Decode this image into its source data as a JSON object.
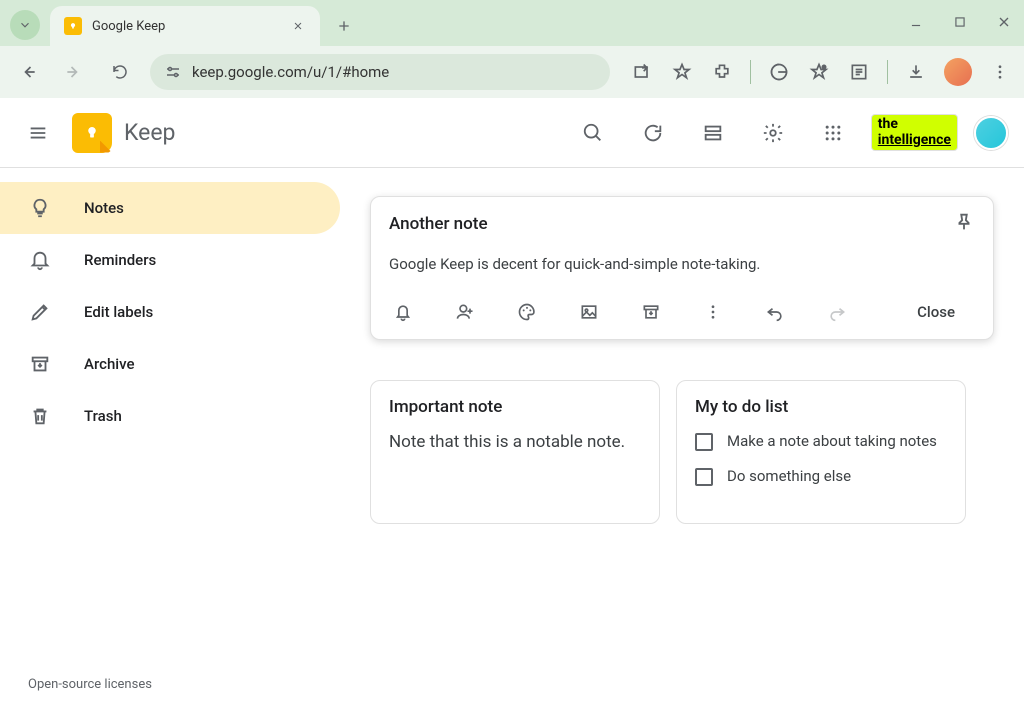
{
  "browser": {
    "tab_title": "Google Keep",
    "url": "keep.google.com/u/1/#home"
  },
  "header": {
    "app_name": "Keep",
    "brand_line1": "the",
    "brand_line2": "intelligence"
  },
  "sidebar": {
    "items": [
      {
        "label": "Notes",
        "active": true
      },
      {
        "label": "Reminders",
        "active": false
      },
      {
        "label": "Edit labels",
        "active": false
      },
      {
        "label": "Archive",
        "active": false
      },
      {
        "label": "Trash",
        "active": false
      }
    ],
    "footer": "Open-source licenses"
  },
  "editor": {
    "title": "Another note",
    "body": "Google Keep is decent for quick-and-simple note-taking.",
    "close_label": "Close"
  },
  "notes": [
    {
      "title": "Important note",
      "body": "Note that this is a notable note."
    },
    {
      "title": "My to do list",
      "todos": [
        {
          "text": "Make a note about taking notes",
          "done": false
        },
        {
          "text": "Do something else",
          "done": false
        }
      ]
    }
  ]
}
